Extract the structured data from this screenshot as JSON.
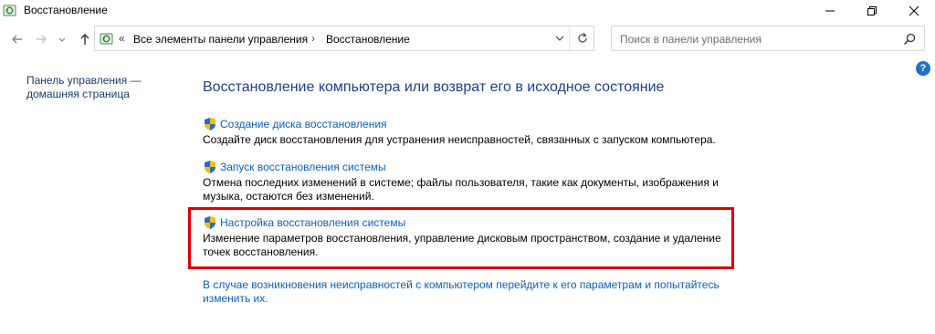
{
  "window": {
    "title": "Восстановление",
    "icon": "recovery-icon"
  },
  "address": {
    "overflow": "«",
    "breadcrumbs": [
      "Все элементы панели управления",
      "Восстановление"
    ],
    "separator": "›"
  },
  "search": {
    "placeholder": "Поиск в панели управления"
  },
  "sidebar": {
    "home_link": "Панель управления — домашняя страница"
  },
  "help": {
    "label": "?"
  },
  "main": {
    "title": "Восстановление компьютера или возврат его в исходное состояние",
    "tasks": [
      {
        "link": "Создание диска восстановления",
        "description": "Создайте диск восстановления для устранения неисправностей, связанных с запуском компьютера."
      },
      {
        "link": "Запуск восстановления системы",
        "description": "Отмена последних изменений в системе; файлы пользователя, такие как документы, изображения и музыка, остаются без изменений."
      },
      {
        "link": "Настройка восстановления системы",
        "description": "Изменение параметров восстановления, управление дисковым пространством, создание и удаление точек восстановления."
      }
    ],
    "bottom_link": "В случае возникновения неисправностей с компьютером перейдите к его параметрам и попытайтесь изменить их."
  },
  "colors": {
    "link": "#0b5ec4",
    "title": "#1e3f8a",
    "highlight": "#e00000",
    "shield_blue": "#2a68c9",
    "shield_yellow": "#f2c200"
  }
}
